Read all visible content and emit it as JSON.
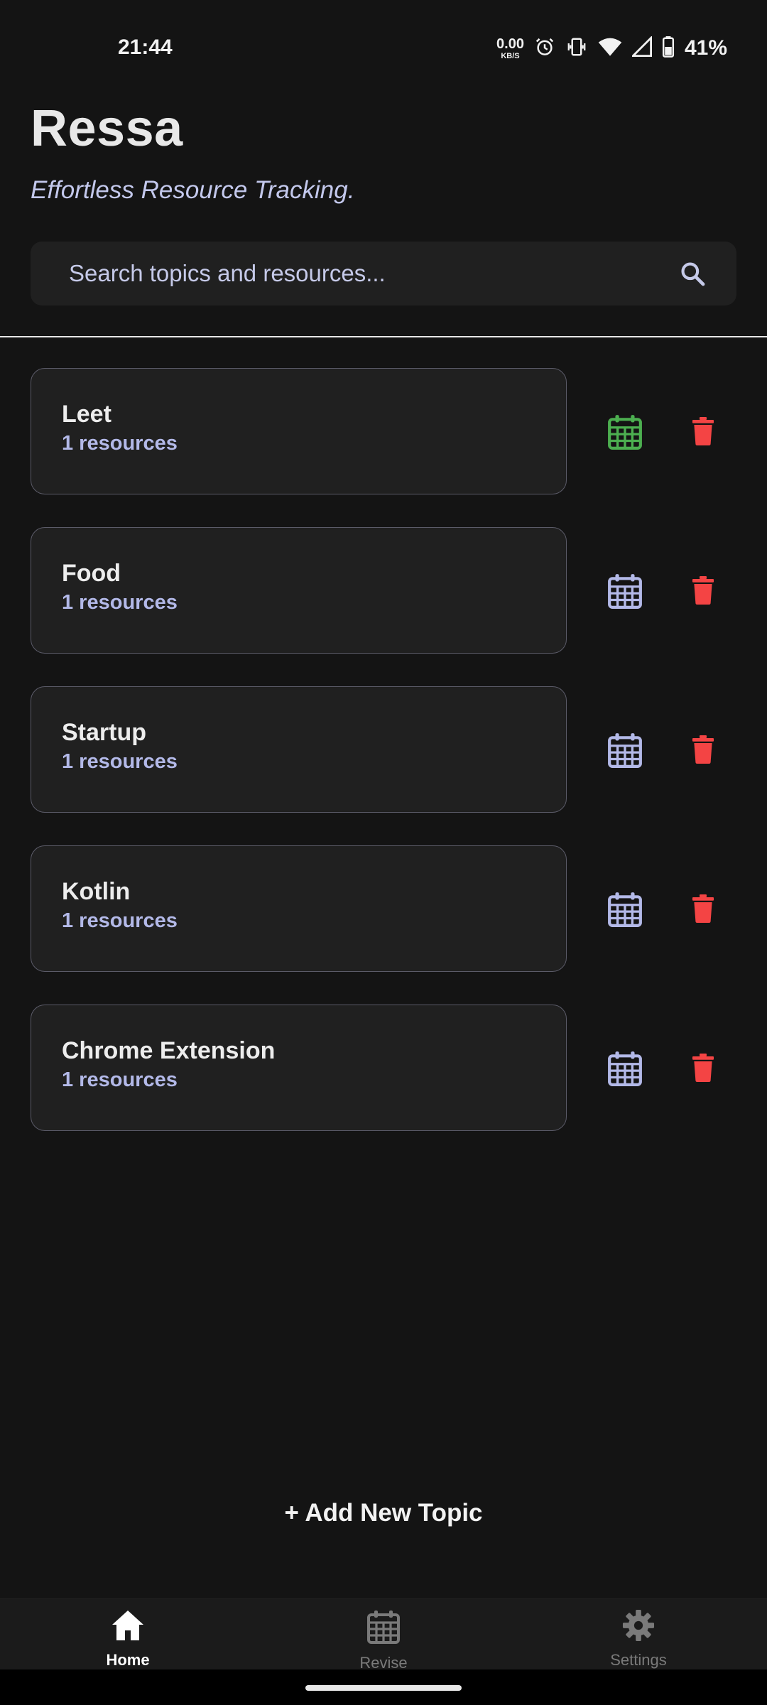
{
  "status_bar": {
    "time": "21:44",
    "net_speed_value": "0.00",
    "net_speed_unit": "KB/S",
    "battery": "41%",
    "icons": [
      "alarm-icon",
      "vibrate-icon",
      "wifi-icon",
      "signal-icon",
      "battery-icon"
    ]
  },
  "header": {
    "title": "Ressa",
    "subtitle": "Effortless Resource Tracking."
  },
  "search": {
    "placeholder": "Search topics and resources...",
    "value": ""
  },
  "topics": [
    {
      "name": "Leet",
      "count": "1 resources",
      "calendar_color": "#4caf50"
    },
    {
      "name": "Food",
      "count": "1 resources",
      "calendar_color": "#b3b9e8"
    },
    {
      "name": "Startup",
      "count": "1 resources",
      "calendar_color": "#b3b9e8"
    },
    {
      "name": "Kotlin",
      "count": "1 resources",
      "calendar_color": "#b3b9e8"
    },
    {
      "name": "Chrome Extension",
      "count": "1 resources",
      "calendar_color": "#b3b9e8"
    }
  ],
  "actions": {
    "add_topic": "+ Add New Topic"
  },
  "bottom_nav": {
    "items": [
      {
        "label": "Home",
        "icon": "home-icon",
        "active": true
      },
      {
        "label": "Revise",
        "icon": "calendar-icon",
        "active": false
      },
      {
        "label": "Settings",
        "icon": "gear-icon",
        "active": false
      }
    ]
  },
  "colors": {
    "background": "#141414",
    "card": "#202020",
    "accent": "#b3b9e8",
    "danger": "#f44444",
    "success": "#4caf50"
  }
}
